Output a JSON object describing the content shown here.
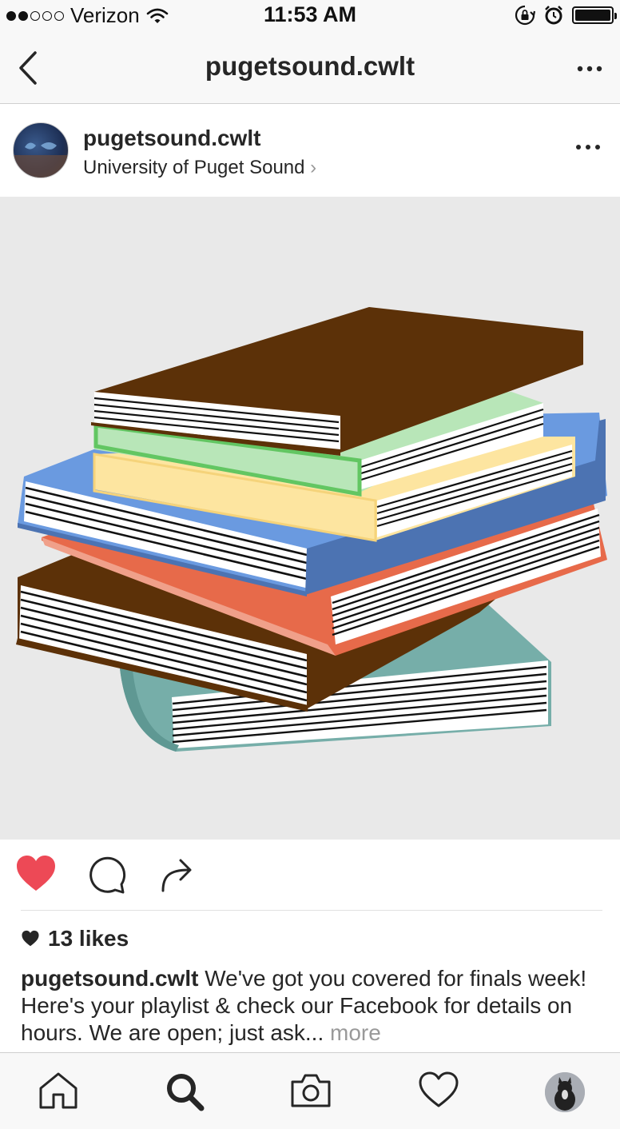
{
  "status_bar": {
    "carrier": "Verizon",
    "signal_filled": 2,
    "signal_total": 5,
    "time": "11:53 AM",
    "battery_level": 1.0
  },
  "nav": {
    "title": "pugetsound.cwlt",
    "back_icon": "chevron-left-icon",
    "more_icon": "ellipsis-icon"
  },
  "post": {
    "username": "pugetsound.cwlt",
    "location": "University of Puget Sound",
    "location_chevron": "›",
    "liked": true,
    "likes_text": "13 likes",
    "caption_username": "pugetsound.cwlt",
    "caption_text": " We've got you covered for finals week! Here's your playlist & check our Facebook for details on hours. We are open; just ask...",
    "caption_more": " more"
  },
  "colors": {
    "like_red": "#ed4956",
    "text": "#262626",
    "muted": "#999999",
    "bar_bg": "#f8f8f8"
  },
  "tabs": [
    {
      "icon": "home-icon"
    },
    {
      "icon": "search-icon",
      "active": true
    },
    {
      "icon": "camera-icon"
    },
    {
      "icon": "heart-icon"
    },
    {
      "icon": "profile-avatar"
    }
  ]
}
